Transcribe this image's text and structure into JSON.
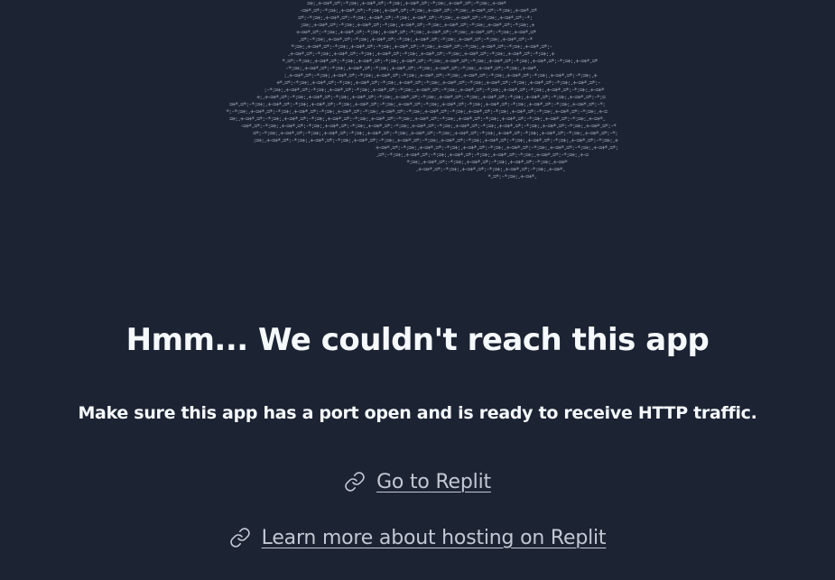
{
  "page": {
    "title": "Hmm... We couldn't reach this app",
    "subtitle": "Make sure this app has a port open and is ready to receive HTTP traffic."
  },
  "links": {
    "go_to_replit": "Go to Replit",
    "learn_more": "Learn more about hosting on Replit"
  },
  "icons": {
    "link_icon": "link-icon",
    "illustration": "ascii-cloud-illustration"
  },
  "colors": {
    "background": "#1c2333",
    "text": "#f5f9fc",
    "link": "#c2c8d4",
    "ascii": "#9aa3b5"
  }
}
